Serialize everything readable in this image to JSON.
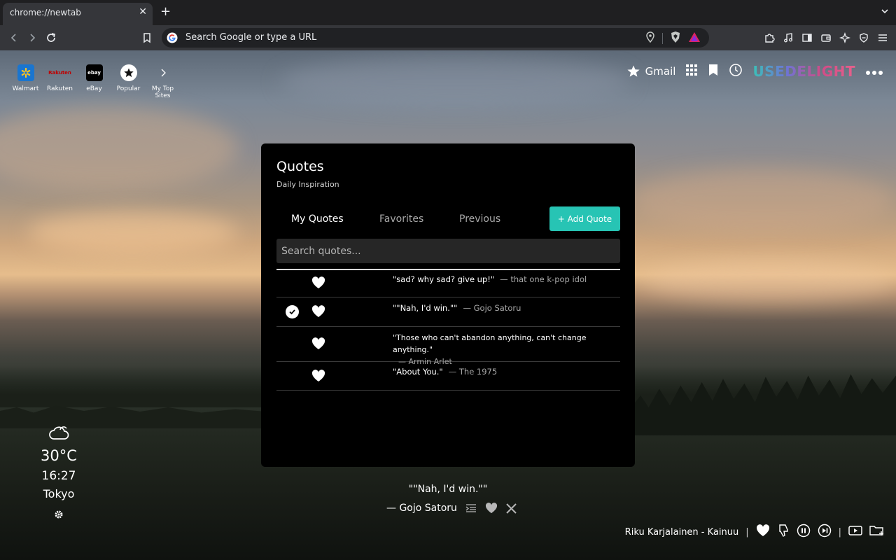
{
  "browser": {
    "tab_title": "chrome://newtab",
    "omnibox_placeholder": "Search Google or type a URL"
  },
  "top_sites": [
    {
      "label": "Walmart",
      "icon": "walmart-icon",
      "color": "#1a75cf"
    },
    {
      "label": "Rakuten",
      "icon": "rakuten-icon",
      "color": "#bf0000"
    },
    {
      "label": "eBay",
      "icon": "ebay-icon",
      "color": "#000000"
    },
    {
      "label": "Popular",
      "icon": "star-icon",
      "color": "#ffffff"
    },
    {
      "label": "My Top Sites",
      "icon": "chevron-right-icon",
      "color": "#ffffff"
    }
  ],
  "top_nav": {
    "gmail_label": "Gmail",
    "brand": "USEDELIGHT"
  },
  "quotes_card": {
    "title": "Quotes",
    "subtitle": "Daily Inspiration",
    "tabs": [
      "My Quotes",
      "Favorites",
      "Previous"
    ],
    "active_tab": "My Quotes",
    "add_button": "+ Add Quote",
    "search_placeholder": "Search quotes...",
    "quotes": [
      {
        "text": "\"sad? why sad? give up!\"",
        "author": "— that one k-pop idol",
        "selected": false
      },
      {
        "text": "\"\"Nah, I'd win.\"\"",
        "author": "— Gojo Satoru",
        "selected": true
      },
      {
        "text": "\"Those who can't abandon anything, can't change anything.\"",
        "author": "— Armin Arlet",
        "selected": false
      },
      {
        "text": "\"About You.\"",
        "author": "— The 1975",
        "selected": false
      }
    ]
  },
  "current_quote": {
    "text": "\"\"Nah, I'd win.\"\"",
    "author": "— Gojo Satoru"
  },
  "weather": {
    "temperature": "30°C",
    "time": "16:27",
    "city": "Tokyo",
    "icon": "cloud-icon"
  },
  "music": {
    "track": "Riku Karjalainen - Kainuu"
  },
  "colors": {
    "accent": "#27c4b4",
    "card_bg": "#000000",
    "search_bg": "#262626"
  }
}
